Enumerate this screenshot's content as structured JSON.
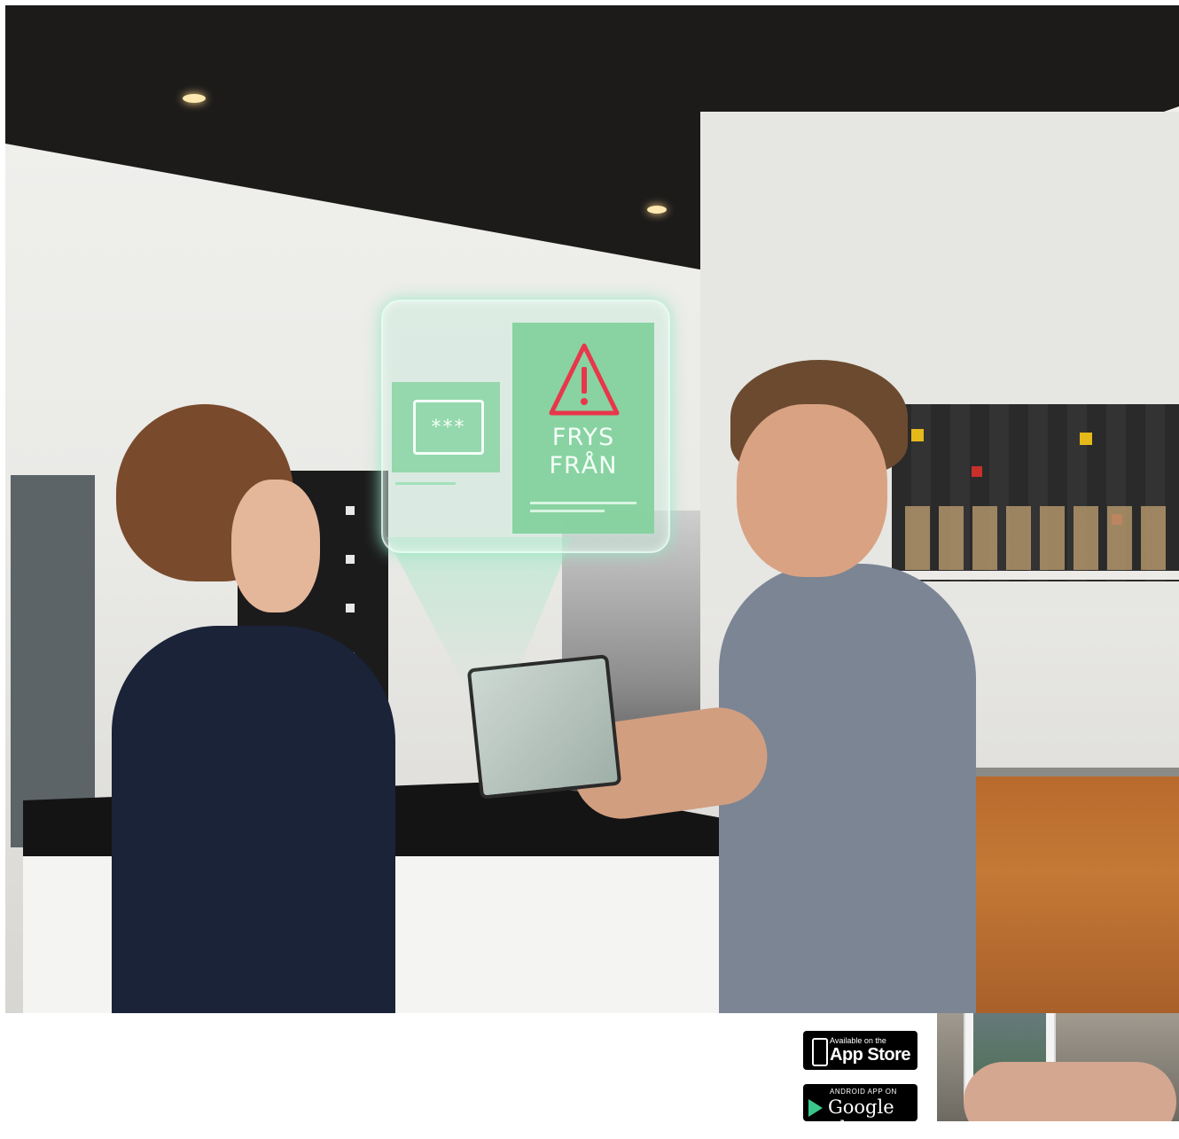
{
  "hologram": {
    "password_mask": "***",
    "alert_text": "FRYS\nFRÅN",
    "icon": "warning-triangle-icon",
    "accent_color": "#84d29d",
    "alert_icon_color": "#e8364b"
  },
  "app_store_badge": {
    "small_text": "Available on the",
    "big_text": "App Store",
    "icon": "apple-icon"
  },
  "google_play_badge": {
    "small_text": "ANDROID APP ON",
    "big_text": "Google play",
    "icon": "play-icon"
  }
}
